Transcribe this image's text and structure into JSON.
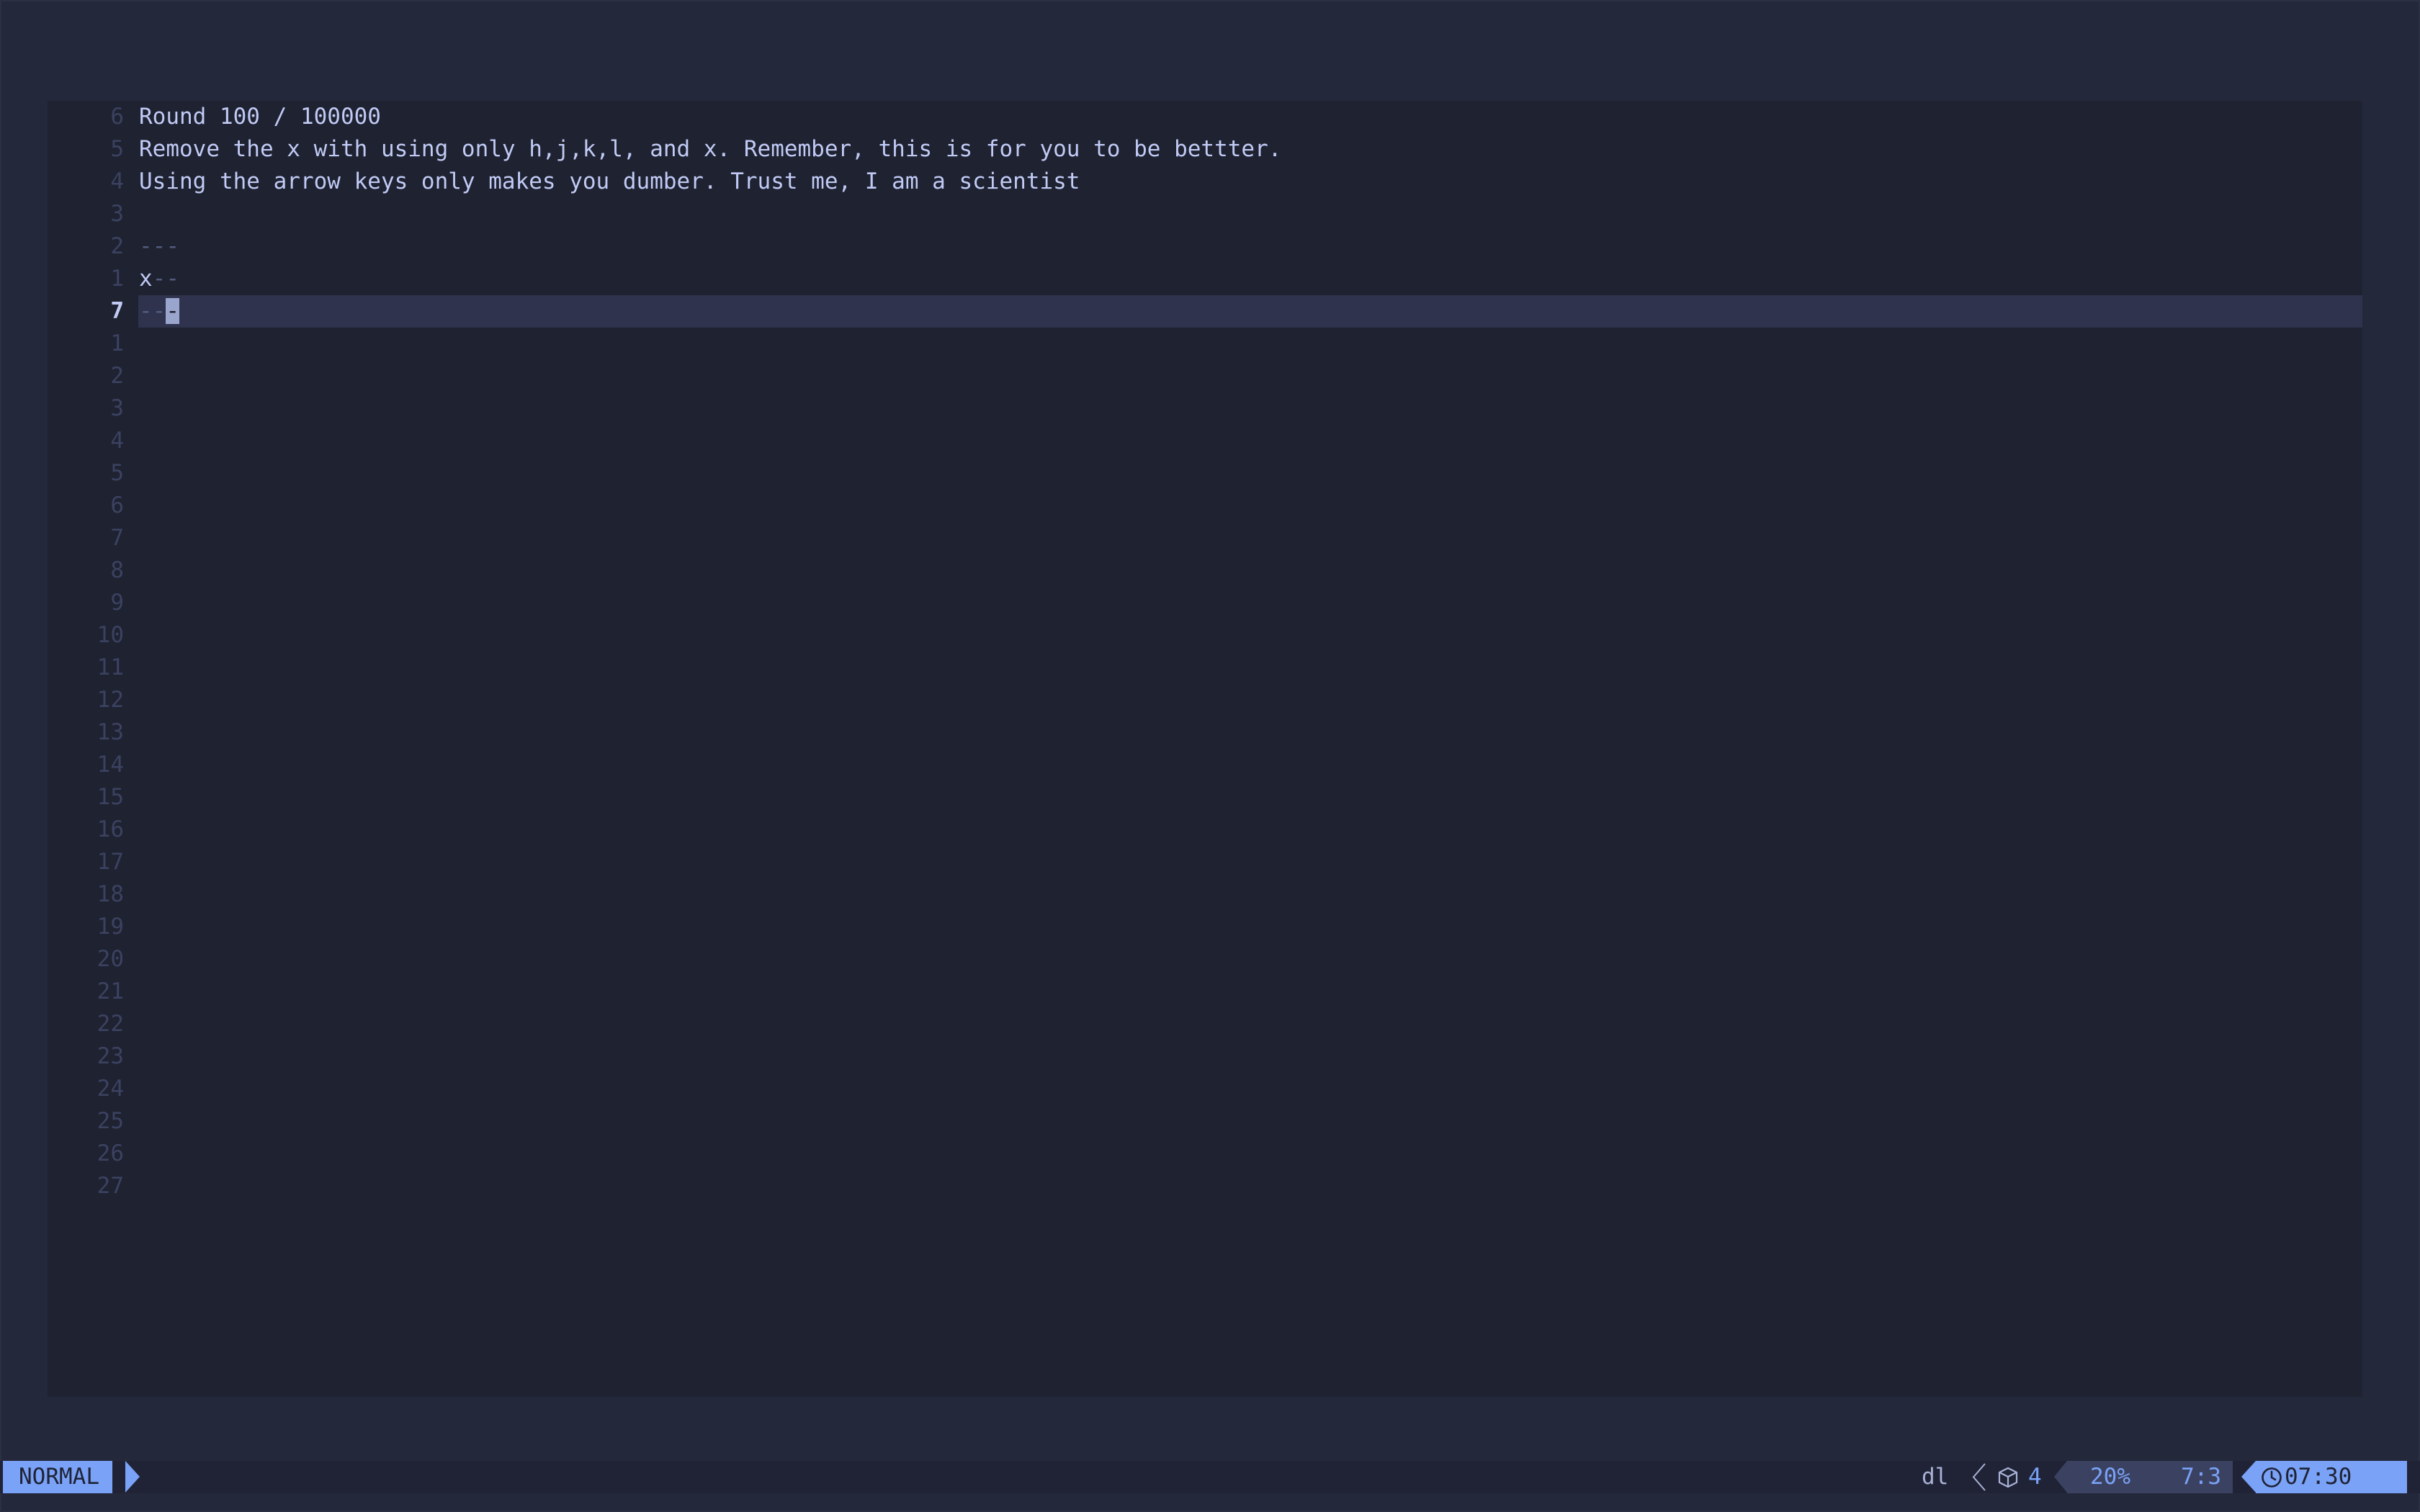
{
  "editor": {
    "current_line_number": "7",
    "lines": [
      {
        "rel": "6",
        "text": "Round 100 / 100000"
      },
      {
        "rel": "5",
        "text": "Remove the x with using only h,j,k,l, and x. Remember, this is for you to be bettter."
      },
      {
        "rel": "4",
        "text": "Using the arrow keys only makes you dumber. Trust me, I am a scientist"
      },
      {
        "rel": "3",
        "text": ""
      },
      {
        "rel": "2",
        "dim_text": "---"
      },
      {
        "rel": "1",
        "text": "x",
        "dim_text": "--"
      },
      {
        "rel": "7",
        "dim_text": "--",
        "cursor_char": "-"
      }
    ],
    "following_line_numbers": [
      "1",
      "2",
      "3",
      "4",
      "5",
      "6",
      "7",
      "8",
      "9",
      "10",
      "11",
      "12",
      "13",
      "14",
      "15",
      "16",
      "17",
      "18",
      "19",
      "20",
      "21",
      "22",
      "23",
      "24",
      "25",
      "26",
      "27"
    ]
  },
  "statusline": {
    "mode": "NORMAL",
    "filetype": "dl",
    "lsp_icon": "package-icon",
    "lsp_count": "4",
    "percent": "20%",
    "position": "7:3",
    "clock_icon": "clock-icon",
    "time": "07:30"
  },
  "colors": {
    "background": "#24283b",
    "editor_bg": "#1f2230",
    "cursorline": "#2f334d",
    "accent": "#7aa2f7",
    "text": "#c0caf5",
    "dim": "#545c7e"
  }
}
